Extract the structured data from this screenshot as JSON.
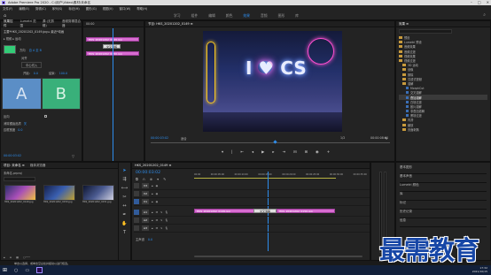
{
  "app": {
    "title": "Adobe Premiere Pro 2020 - C:\\用户\\Video\\素材\\未命名"
  },
  "menu": [
    "文件(F)",
    "编辑(E)",
    "剪辑(C)",
    "序列(S)",
    "标记(M)",
    "图形(G)",
    "视图(V)",
    "窗口(W)",
    "帮助(H)"
  ],
  "workspaces": [
    "学习",
    "组件",
    "编辑",
    "颜色",
    "效果",
    "音频",
    "图形",
    "库"
  ],
  "active_workspace": "效果",
  "effect_controls": {
    "tabs": [
      "效果控件",
      "Lumetri 范围",
      "源:(无剪辑)",
      "音频剪辑混合器"
    ],
    "header": "主要*HKS_20201202_0149.jpg ▸ 最近*动画",
    "motion_row": "▸ 视频 ▸ 运动",
    "direction_label": "方向",
    "direction_value": "自 A 至 B",
    "alignment_label": "对齐",
    "alignment_value": "中心切入",
    "a_label": "A",
    "b_label": "B",
    "reverse_label": "反向",
    "antialias_label": "消除锯齿品质",
    "antialias_value": "关",
    "border_label": "边框宽度",
    "border_value": "0.0",
    "timecode": "00:00:03:02"
  },
  "ec_timeline": {
    "clip1": "HKS_20201202_0149.jpg",
    "clip2": "HKS_20201202_0150.jpg",
    "transition": "交叉溶解"
  },
  "program": {
    "title": "节目: HKS_20201202_0149 ≡",
    "timecode_left": "00:00:03:02",
    "fit": "适合",
    "ratio": "1/2",
    "timecode_right": "00:00:08:00",
    "neon_text": "I ♥ CS"
  },
  "effects": {
    "tab": "效果 ≡",
    "items": [
      {
        "label": "预设",
        "type": "folder",
        "indent": 0
      },
      {
        "label": "Lumetri 预设",
        "type": "folder",
        "indent": 0
      },
      {
        "label": "音频效果",
        "type": "folder",
        "indent": 0
      },
      {
        "label": "音频过渡",
        "type": "folder",
        "indent": 0
      },
      {
        "label": "视频效果",
        "type": "folder",
        "indent": 0
      },
      {
        "label": "视频过渡",
        "type": "folder",
        "indent": 0
      },
      {
        "label": "3D 运动",
        "type": "folder",
        "indent": 1
      },
      {
        "label": "划像",
        "type": "folder",
        "indent": 1
      },
      {
        "label": "擦除",
        "type": "folder",
        "indent": 1
      },
      {
        "label": "沉浸式视频",
        "type": "folder",
        "indent": 1
      },
      {
        "label": "溶解",
        "type": "folder",
        "indent": 1
      },
      {
        "label": "MorphCut",
        "type": "fx",
        "indent": 2
      },
      {
        "label": "交叉溶解",
        "type": "fx",
        "indent": 2
      },
      {
        "label": "叠加溶解",
        "type": "fx",
        "indent": 2,
        "selected": true
      },
      {
        "label": "白场过渡",
        "type": "fx",
        "indent": 2
      },
      {
        "label": "胶片溶解",
        "type": "fx",
        "indent": 2
      },
      {
        "label": "非叠加溶解",
        "type": "fx",
        "indent": 2
      },
      {
        "label": "黑场过渡",
        "type": "fx",
        "indent": 2
      },
      {
        "label": "内滑",
        "type": "folder",
        "indent": 1
      },
      {
        "label": "缩放",
        "type": "folder",
        "indent": 1
      },
      {
        "label": "页面剥落",
        "type": "folder",
        "indent": 1
      }
    ],
    "panels": [
      "基本图形",
      "基本声音",
      "Lumetri 颜色",
      "库",
      "标记",
      "历史记录",
      "信息"
    ]
  },
  "project": {
    "tabs": [
      "项目: 未命名 ≡",
      "媒体浏览器"
    ],
    "name": "未命名.prproj",
    "count": "5 个项",
    "items": [
      {
        "label": "HKS_20201202_0149.jpg",
        "dur": "5:00"
      },
      {
        "label": "HKS_20201202_0150.jpg",
        "dur": "5:00"
      },
      {
        "label": "HKS_20201202_0151.jpg",
        "dur": "5:00"
      }
    ]
  },
  "sequence": {
    "tab": "HKS_20201202_0149 ≡",
    "timecode": "00:00:03:02",
    "ruler": [
      "00:00",
      "00:00:05:00",
      "00:00:10:00",
      "00:00:15:00",
      "00:00:20:00",
      "00:00:25:00",
      "00:00:30:00",
      "00:00:35:00"
    ],
    "video_tracks": [
      "V3",
      "V2",
      "V1"
    ],
    "audio_tracks": [
      "A1",
      "A2",
      "A3"
    ],
    "master": "主声道",
    "master_value": "0.0",
    "clip1": "HKS_20201202_0149.jpg",
    "clip2": "HKS_20201202_0150.jpg",
    "transition": "交叉溶解"
  },
  "status": {
    "text": "单击以选择，或单击空白处并拖动以进行框选。"
  },
  "taskbar": {
    "time": "17:32",
    "date": "2021/10/15"
  },
  "watermark": {
    "text": "最需教育"
  }
}
